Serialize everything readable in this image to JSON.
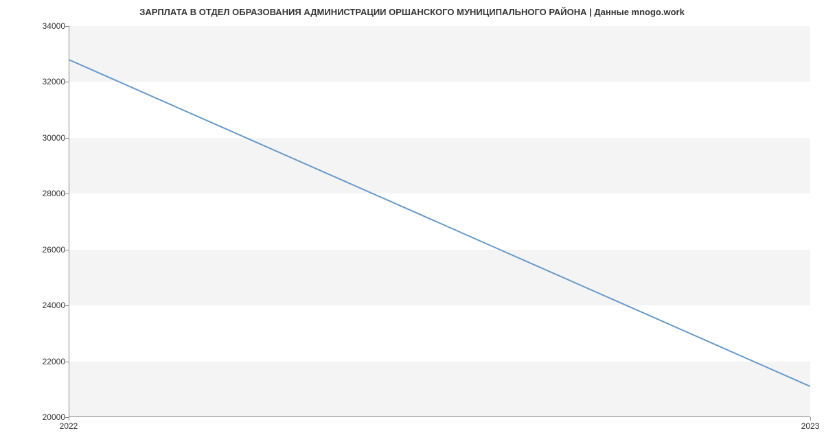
{
  "chart_data": {
    "type": "line",
    "title": "ЗАРПЛАТА В ОТДЕЛ ОБРАЗОВАНИЯ АДМИНИСТРАЦИИ ОРШАНСКОГО МУНИЦИПАЛЬНОГО РАЙОНА | Данные mnogo.work",
    "x": [
      2022,
      2023
    ],
    "values": [
      32800,
      21100
    ],
    "xlabel": "",
    "ylabel": "",
    "xlim": [
      2022,
      2023
    ],
    "ylim": [
      20000,
      34000
    ],
    "y_ticks": [
      20000,
      22000,
      24000,
      26000,
      28000,
      30000,
      32000,
      34000
    ],
    "x_ticks": [
      2022,
      2023
    ],
    "line_color": "#6699cc"
  }
}
